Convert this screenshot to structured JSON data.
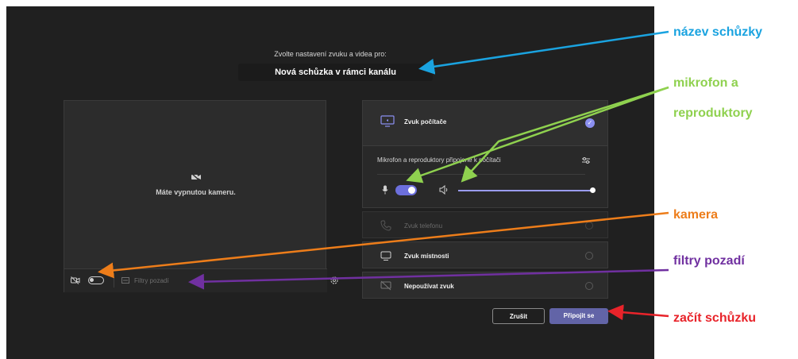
{
  "dialog": {
    "subtitle": "Zvolte nastavení zvuku a videa pro:",
    "meeting_name": "Nová schůzka v rámci kanálu"
  },
  "video_preview": {
    "camera_off_text": "Máte vypnutou kameru.",
    "filters_label": "Filtry pozadí",
    "camera_toggle_state": "off"
  },
  "audio_options": {
    "computer": {
      "label": "Zvuk počítače",
      "selected": true,
      "device_text": "Mikrofon a reproduktory připojené k počítači",
      "mic_toggle_state": "on",
      "speaker_volume_fraction": 1.0
    },
    "phone_label": "Zvuk telefonu",
    "room_label": "Zvuk místnosti",
    "no_audio_label": "Nepoužívat zvuk"
  },
  "buttons": {
    "cancel": "Zrušit",
    "join": "Připojit se"
  },
  "annotations": {
    "meeting_name": "název schůzky",
    "mic_speakers_line1": "mikrofon a",
    "mic_speakers_line2": "reproduktory",
    "camera": "kamera",
    "background_filters": "filtry pozadí",
    "start_meeting": "začít schůzku"
  },
  "colors": {
    "annotation_blue": "#1aa3e0",
    "annotation_green": "#8fd14f",
    "annotation_orange": "#ed7d1a",
    "annotation_purple": "#7030a0",
    "annotation_red": "#e8232a",
    "accent": "#6264a7"
  }
}
